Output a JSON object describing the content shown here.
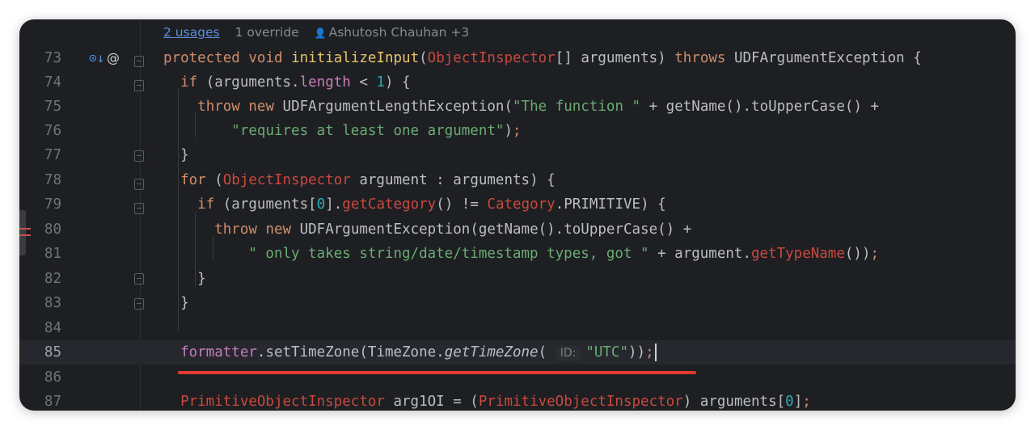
{
  "inlay_hints": {
    "usages": "2 usages",
    "override": "1 override",
    "author": "Ashutosh Chauhan +3"
  },
  "gutter_icons": {
    "implementation": "⊙↓",
    "annotation": "@"
  },
  "param_hint": "ID:",
  "lines": [
    {
      "num": "73"
    },
    {
      "num": "74"
    },
    {
      "num": "75"
    },
    {
      "num": "76"
    },
    {
      "num": "77"
    },
    {
      "num": "78"
    },
    {
      "num": "79"
    },
    {
      "num": "80"
    },
    {
      "num": "81"
    },
    {
      "num": "82"
    },
    {
      "num": "83"
    },
    {
      "num": "84"
    },
    {
      "num": "85"
    },
    {
      "num": "86"
    },
    {
      "num": "87"
    }
  ],
  "colors": {
    "background": "#1e1f22",
    "keyword": "#cf8e6d",
    "string": "#6aab73",
    "annotation_underline": "#e23b2e"
  }
}
